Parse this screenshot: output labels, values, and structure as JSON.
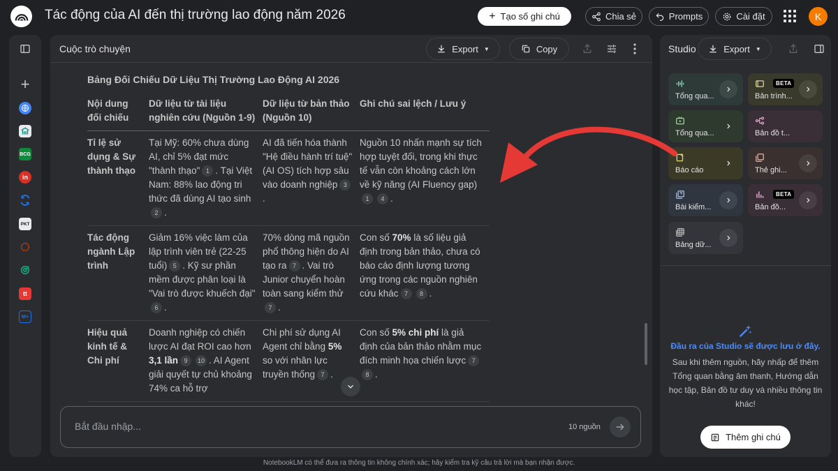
{
  "header": {
    "title": "Tác động của AI đến thị trường lao động năm 2026",
    "new_note": "Tạo số ghi chú",
    "share": "Chia sẻ",
    "prompts": "Prompts",
    "settings": "Cài đặt",
    "avatar_letter": "K"
  },
  "chat": {
    "title": "Cuộc trò chuyện",
    "export": "Export",
    "copy": "Copy",
    "table_title": "Bảng Đối Chiếu Dữ Liệu Thị Trường Lao Động AI 2026",
    "headers": [
      "Nội dung đối chiếu",
      "Dữ liệu từ tài liệu nghiên cứu (Nguồn 1-9)",
      "Dữ liệu từ bản thảo (Nguồn 10)",
      "Ghi chú sai lệch / Lưu ý"
    ],
    "rows": [
      {
        "label": "Tỉ lệ sử dụng & Sự thành thạo",
        "c1": "Tại Mỹ: 60% chưa dùng AI, chỉ 5% đạt mức \"thành thạo\"",
        "c1_cite": "1",
        "c1b": ". Tại Việt Nam: 88% lao động tri thức đã dùng AI tạo sinh",
        "c1b_cite": "2",
        "c2": "AI đã tiến hóa thành \"Hệ điều hành trí tuệ\" (AI OS) tích hợp sâu vào doanh nghiệp",
        "c2_cite": "3",
        "c3": "Nguồn 10 nhấn mạnh sự tích hợp tuyệt đối, trong khi thực tế vẫn còn khoảng cách lớn về kỹ năng (AI Fluency gap)",
        "c3_cite1": "1",
        "c3_cite2": "4"
      },
      {
        "label": "Tác động ngành Lập trình",
        "c1": "Giảm 16% việc làm của lập trình viên trẻ (22-25 tuổi)",
        "c1_cite": "5",
        "c1b": ". Kỹ sư phần mềm được phân loại là \"Vai trò được khuếch đại\"",
        "c1b_cite": "6",
        "c2": "70% dòng mã nguồn phổ thông hiện do AI tạo ra",
        "c2_cite": "7",
        "c2b": ". Vai trò Junior chuyển hoàn toàn sang kiểm thử",
        "c2b_cite": "7",
        "c3_pre": "Con số ",
        "c3_bold": "70%",
        "c3_post": " là số liệu giả định trong bản thảo, chưa có báo cáo định lượng tương ứng trong các nguồn nghiên cứu khác",
        "c3_cite1": "7",
        "c3_cite2": "8"
      },
      {
        "label": "Hiệu quả kinh tế & Chi phí",
        "c1_pre": "Doanh nghiệp có chiến lược AI đạt ROI cao hơn ",
        "c1_bold": "3,1 lần",
        "c1_cite1": "9",
        "c1_cite2": "10",
        "c1_post": ". AI Agent giải quyết tự chủ khoảng 74% ca hỗ trợ",
        "c2_pre": "Chi phí sử dụng AI Agent chỉ bằng ",
        "c2_bold": "5%",
        "c2_post": " so với nhân lực truyền thống",
        "c2_cite": "7",
        "c3_pre": "Con số ",
        "c3_bold": "5% chi phí",
        "c3_post": " là giả định của bản thảo nhằm mục đích minh họa chiến lược",
        "c3_cite1": "7",
        "c3_cite2": "8"
      }
    ],
    "input_placeholder": "Bắt đầu nhập...",
    "source_count": "10 nguồn"
  },
  "studio": {
    "title": "Studio",
    "export": "Export",
    "tiles": [
      {
        "label": "Tổng qua...",
        "icon": "audio-wave-icon",
        "bg": "#2d3a37",
        "fg": "#8fd3c0"
      },
      {
        "label": "Bản trình...",
        "icon": "slides-icon",
        "bg": "#3a3a2c",
        "fg": "#e0d49a",
        "beta": "BETA"
      },
      {
        "label": "Tổng qua...",
        "icon": "video-icon",
        "bg": "#2f3a2f",
        "fg": "#9fd39a"
      },
      {
        "label": "Bản đồ t...",
        "icon": "mindmap-icon",
        "bg": "#3a2f37",
        "fg": "#e0a9cf"
      },
      {
        "label": "Báo cáo",
        "icon": "report-icon",
        "bg": "#3b3a26",
        "fg": "#e6d77a"
      },
      {
        "label": "Thẻ ghi...",
        "icon": "flashcard-icon",
        "bg": "#39302f",
        "fg": "#e6b3a3"
      },
      {
        "label": "Bài kiểm...",
        "icon": "quiz-icon",
        "bg": "#2f3640",
        "fg": "#a8c4e6"
      },
      {
        "label": "Bản đồ...",
        "icon": "chart-icon",
        "bg": "#3a2e37",
        "fg": "#e0a9cf",
        "beta": "BETA"
      },
      {
        "label": "Bảng dữ...",
        "icon": "table-icon",
        "bg": "#33353a",
        "fg": "#c4c7c5"
      }
    ],
    "empty_title": "Đầu ra của Studio sẽ được lưu ở đây.",
    "empty_desc": "Sau khi thêm nguồn, hãy nhấp để thêm Tổng quan bằng âm thanh, Hướng dẫn học tập, Bản đồ tư duy và nhiều thông tin khác!",
    "add_note": "Thêm ghi chú"
  },
  "sources": [
    {
      "icon": "globe-icon",
      "color": "#4285f4"
    },
    {
      "icon": "building-icon",
      "color": "#00897b"
    },
    {
      "icon": "bcg-logo-icon",
      "color": "#0f8a3b",
      "text": "BCG"
    },
    {
      "icon": "linkedin-icon",
      "color": "#d93025",
      "text": "in"
    },
    {
      "icon": "refresh-logo-icon",
      "color": "#1a73e8"
    },
    {
      "icon": "pkt-logo-icon",
      "color": "#e8eaed",
      "text": "PKT"
    },
    {
      "icon": "ring-logo-icon",
      "color": "#e8430a"
    },
    {
      "icon": "target-icon",
      "color": "#1aa67a"
    },
    {
      "icon": "tt-logo-icon",
      "color": "#e53935",
      "text": "tt"
    },
    {
      "icon": "m-logo-icon",
      "color": "#1a73e8",
      "text": "M+"
    }
  ],
  "footer": "NotebookLM có thể đưa ra thông tin không chính xác; hãy kiểm tra kỹ câu trả lời mà bạn nhận được."
}
